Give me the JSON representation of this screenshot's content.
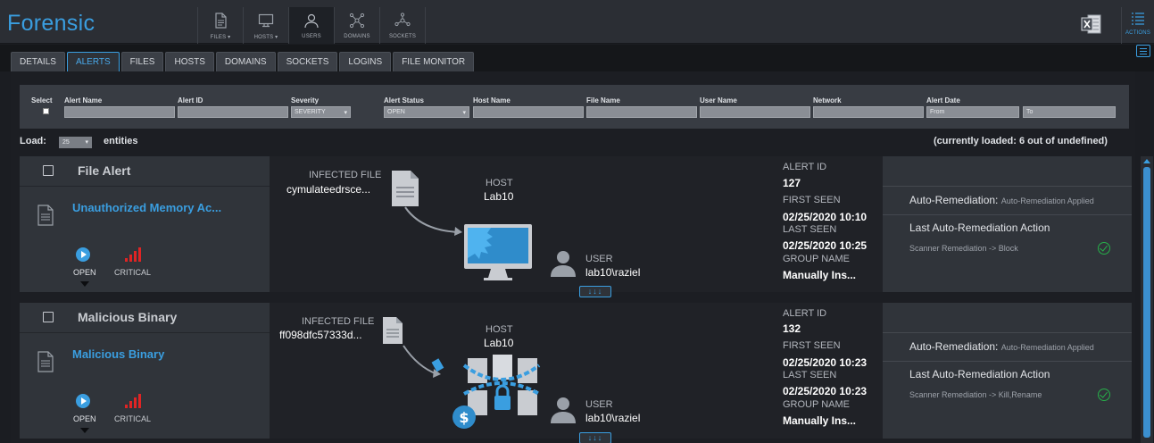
{
  "app": {
    "title": "Forensic"
  },
  "nav": [
    {
      "label": "FILES ▾",
      "icon": "file-icon"
    },
    {
      "label": "HOSTS ▾",
      "icon": "monitor-icon"
    },
    {
      "label": "USERS",
      "icon": "user-icon"
    },
    {
      "label": "DOMAINS",
      "icon": "network-icon"
    },
    {
      "label": "SOCKETS",
      "icon": "network-icon"
    }
  ],
  "actions": {
    "label": "ACTIONS"
  },
  "tabs": [
    "DETAILS",
    "ALERTS",
    "FILES",
    "HOSTS",
    "DOMAINS",
    "SOCKETS",
    "LOGINS",
    "FILE MONITOR"
  ],
  "active_tab": "ALERTS",
  "filters": {
    "select": "Select",
    "alert_name": "Alert Name",
    "alert_id": "Alert ID",
    "severity": "Severity",
    "severity_value": "SEVERITY",
    "alert_status": "Alert Status",
    "alert_status_value": "OPEN",
    "host_name": "Host Name",
    "file_name": "File Name",
    "user_name": "User Name",
    "network": "Network",
    "alert_date": "Alert Date",
    "date_from": "From",
    "date_to": "To"
  },
  "load": {
    "label": "Load:",
    "value": "25",
    "entities": "entities",
    "status": "(currently loaded: 6 out of undefined)"
  },
  "labels": {
    "infected_file": "INFECTED FILE",
    "host": "HOST",
    "user": "USER",
    "alert_id": "ALERT ID",
    "first_seen": "FIRST SEEN",
    "last_seen": "LAST SEEN",
    "group_name": "GROUP NAME",
    "open": "OPEN",
    "critical": "CRITICAL",
    "auto_remediation": "Auto-Remediation:",
    "last_action": "Last Auto-Remediation Action",
    "expander": "↓↓↓"
  },
  "alerts": [
    {
      "type": "File Alert",
      "name": "Unauthorized Memory Ac...",
      "file": "cymulateedrsce...",
      "host": "Lab10",
      "user": "lab10\\raziel",
      "id": "127",
      "first_seen": "02/25/2020 10:10",
      "last_seen": "02/25/2020 10:25",
      "group": "Manually Ins...",
      "status": "OPEN",
      "severity": "CRITICAL",
      "auto_remediation": "Auto-Remediation Applied",
      "last_action": "Scanner Remediation -> Block",
      "graphic": "infected-monitor"
    },
    {
      "type": "Malicious Binary",
      "name": "Malicious Binary",
      "file": "ff098dfc57333d...",
      "host": "Lab10",
      "user": "lab10\\raziel",
      "id": "132",
      "first_seen": "02/25/2020 10:23",
      "last_seen": "02/25/2020 10:23",
      "group": "Manually Ins...",
      "status": "OPEN",
      "severity": "CRITICAL",
      "auto_remediation": "Auto-Remediation Applied",
      "last_action": "Scanner Remediation -> Kill,Rename",
      "graphic": "ransomware-files"
    }
  ],
  "colors": {
    "accent": "#3a9ee0",
    "critical": "#e02424",
    "ok": "#27b04a"
  }
}
